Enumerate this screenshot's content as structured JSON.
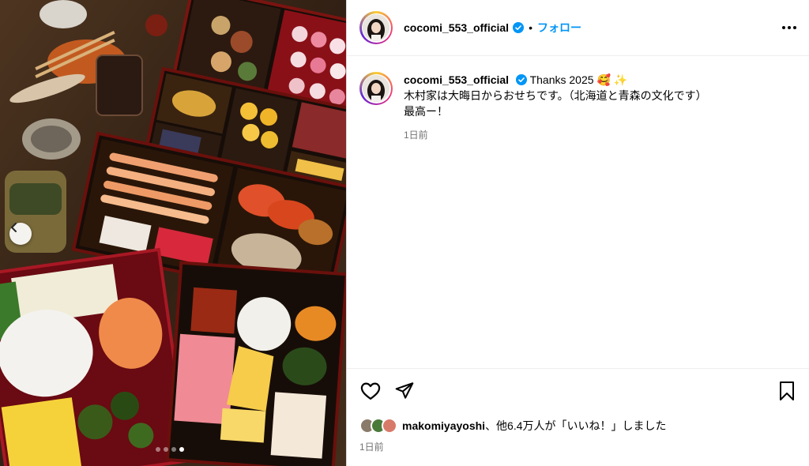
{
  "post": {
    "author": {
      "username": "cocomi_553_official",
      "verified": true
    },
    "header": {
      "separator": "•",
      "follow_label": "フォロー"
    },
    "caption": {
      "first_line": "Thanks 2025",
      "emojis": "🥰 ✨",
      "line2": "木村家は大晦日からおせちです。（北海道と青森の文化です）",
      "line3": "最高ー！"
    },
    "caption_time": "1日前",
    "likes": {
      "liker": "makomiyayoshi",
      "rest": "、他6.4万人が「いいね！」しました"
    },
    "post_time": "1日前",
    "carousel": {
      "total": 4,
      "active_index": 3
    }
  },
  "colors": {
    "accent": "#0095f6",
    "verified_badge": "#0095f6",
    "muted_text": "#737373"
  },
  "icons": {
    "prev": "chevron-left-icon",
    "like": "heart-icon",
    "share": "send-icon",
    "save": "bookmark-icon",
    "more": "more-horizontal-icon"
  }
}
